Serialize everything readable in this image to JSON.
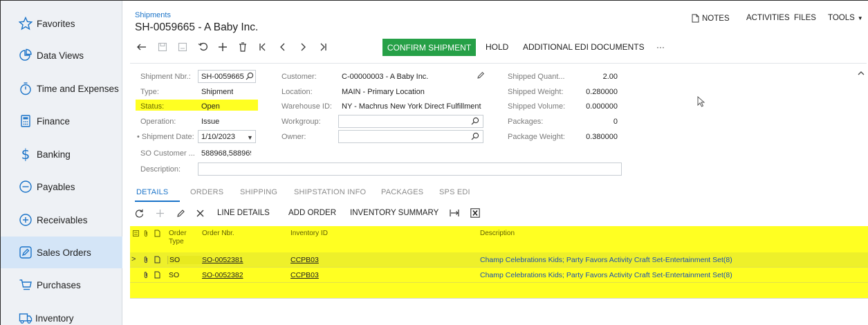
{
  "sidebar": {
    "items": [
      {
        "label": "Favorites",
        "icon": "star-icon"
      },
      {
        "label": "Data Views",
        "icon": "pie-chart-icon"
      },
      {
        "label": "Time and Expenses",
        "icon": "stopwatch-icon"
      },
      {
        "label": "Finance",
        "icon": "calculator-icon"
      },
      {
        "label": "Banking",
        "icon": "dollar-icon"
      },
      {
        "label": "Payables",
        "icon": "minus-circle-icon"
      },
      {
        "label": "Receivables",
        "icon": "plus-circle-icon"
      },
      {
        "label": "Sales Orders",
        "icon": "pencil-square-icon"
      },
      {
        "label": "Purchases",
        "icon": "cart-icon"
      },
      {
        "label": "Inventory",
        "icon": "truck-icon"
      }
    ],
    "active_index": 7
  },
  "header": {
    "breadcrumb": "Shipments",
    "title": "SH-0059665 - A Baby Inc.",
    "top_menu": {
      "notes": "NOTES",
      "activities": "ACTIVITIES",
      "files": "FILES",
      "tools": "TOOLS"
    }
  },
  "toolbar": {
    "confirm": "CONFIRM SHIPMENT",
    "hold": "HOLD",
    "edi": "ADDITIONAL EDI DOCUMENTS",
    "more": "···"
  },
  "form": {
    "shipment_nbr": {
      "label": "Shipment Nbr.:",
      "value": "SH-0059665"
    },
    "type": {
      "label": "Type:",
      "value": "Shipment"
    },
    "status": {
      "label": "Status:",
      "value": "Open"
    },
    "operation": {
      "label": "Operation:",
      "value": "Issue"
    },
    "shipment_date": {
      "label": "• Shipment Date:",
      "value": "1/10/2023"
    },
    "so_customer": {
      "label": "SO Customer ...",
      "value": "588968,588969"
    },
    "description": {
      "label": "Description:",
      "value": ""
    },
    "customer": {
      "label": "Customer:",
      "value": "C-00000003 - A Baby Inc."
    },
    "location": {
      "label": "Location:",
      "value": "MAIN - Primary Location"
    },
    "warehouse": {
      "label": "Warehouse ID:",
      "value": "NY - Machrus New York Direct Fulfillment"
    },
    "workgroup": {
      "label": "Workgroup:",
      "value": ""
    },
    "owner": {
      "label": "Owner:",
      "value": ""
    },
    "shipped_quantity": {
      "label": "Shipped Quant...",
      "value": "2.00"
    },
    "shipped_weight": {
      "label": "Shipped Weight:",
      "value": "0.280000"
    },
    "shipped_volume": {
      "label": "Shipped Volume:",
      "value": "0.000000"
    },
    "packages": {
      "label": "Packages:",
      "value": "0"
    },
    "package_weight": {
      "label": "Package Weight:",
      "value": "0.380000"
    }
  },
  "tabs": [
    "DETAILS",
    "ORDERS",
    "SHIPPING",
    "SHIPSTATION INFO",
    "PACKAGES",
    "SPS EDI"
  ],
  "grid_toolbar": {
    "line_details": "LINE DETAILS",
    "add_order": "ADD ORDER",
    "inventory_summary": "INVENTORY SUMMARY"
  },
  "grid": {
    "columns": {
      "order_type_1": "Order",
      "order_type_2": "Type",
      "order_nbr": "Order Nbr.",
      "inventory_id": "Inventory ID",
      "description": "Description"
    },
    "rows": [
      {
        "order_type": "SO",
        "order_nbr": "SO-0052381",
        "inventory_id": "CCPB03",
        "description": "Champ Celebrations Kids; Party Favors Activity Craft Set-Entertainment Set(8)"
      },
      {
        "order_type": "SO",
        "order_nbr": "SO-0052382",
        "inventory_id": "CCPB03",
        "description": "Champ Celebrations Kids; Party Favors Activity Craft Set-Entertainment Set(8)"
      }
    ]
  },
  "colors": {
    "accent": "#1a73c8",
    "confirm_button": "#26a047",
    "highlight": "#ffff22",
    "sidebar_bg": "#eef1f5",
    "sidebar_active": "#d4e5f7"
  }
}
